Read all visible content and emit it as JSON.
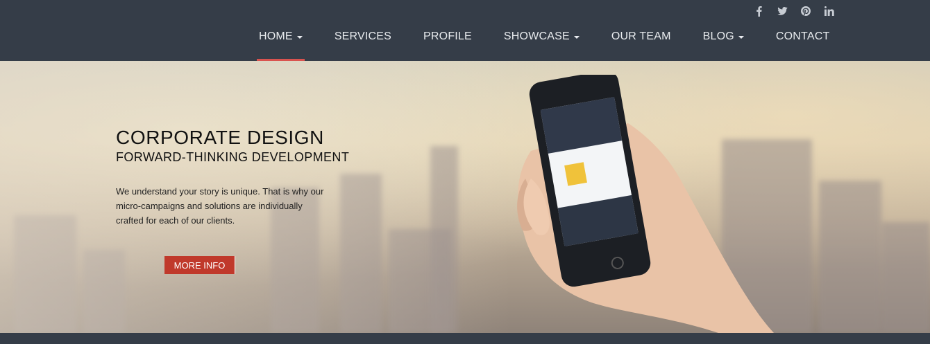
{
  "social": [
    "facebook-icon",
    "twitter-icon",
    "pinterest-icon",
    "linkedin-icon"
  ],
  "nav": {
    "items": [
      {
        "label": "HOME",
        "dropdown": true,
        "active": true
      },
      {
        "label": "SERVICES",
        "dropdown": false
      },
      {
        "label": "PROFILE",
        "dropdown": false
      },
      {
        "label": "SHOWCASE",
        "dropdown": true
      },
      {
        "label": "OUR TEAM",
        "dropdown": false
      },
      {
        "label": "BLOG",
        "dropdown": true
      },
      {
        "label": "CONTACT",
        "dropdown": false
      }
    ]
  },
  "hero": {
    "title": "CORPORATE DESIGN",
    "subtitle": "FORWARD-THINKING DEVELOPMENT",
    "body": "We understand your story is unique. That is why our micro-campaigns and solutions are individually crafted for each of our clients.",
    "button": "MORE INFO"
  },
  "colors": {
    "bar": "#353d48",
    "accent": "#c0392b",
    "active_underline": "#d9534f"
  }
}
